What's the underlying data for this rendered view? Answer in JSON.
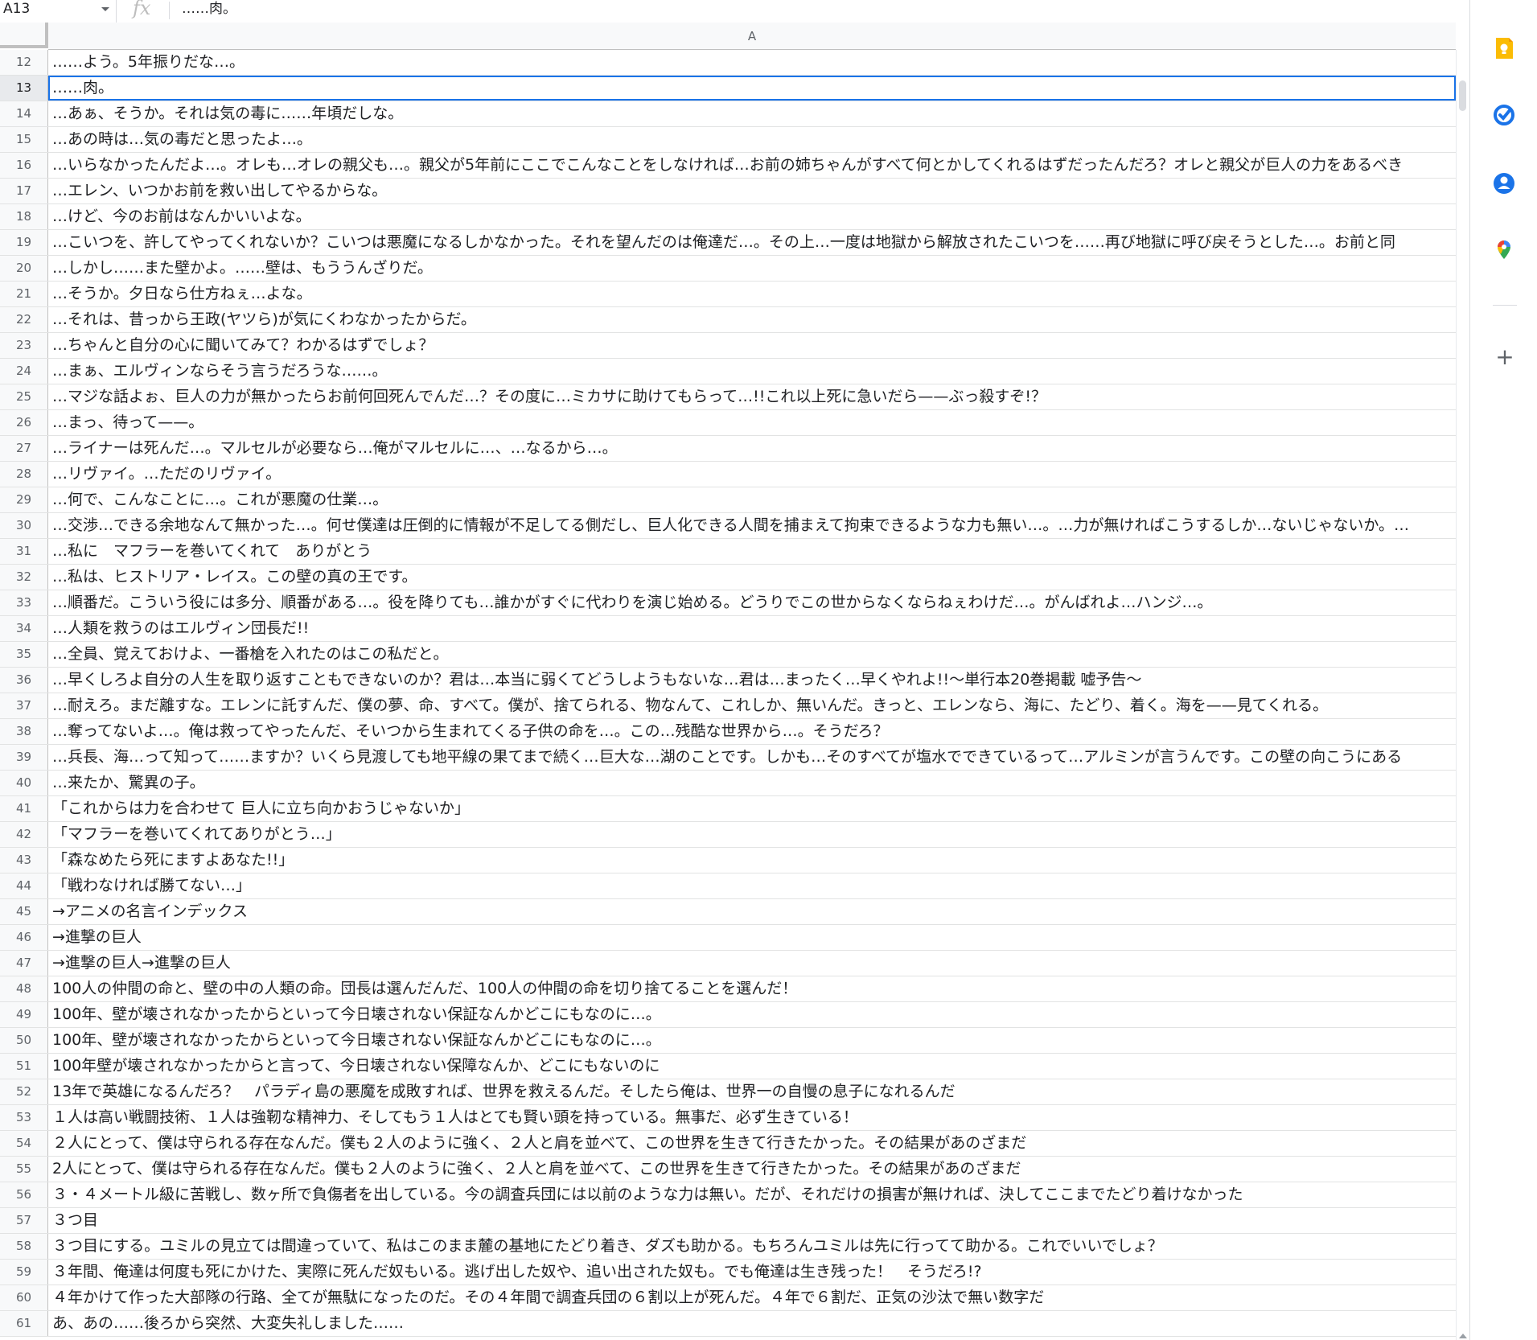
{
  "formula_bar": {
    "name_box": "A13",
    "fx": "fx",
    "value": "……肉。"
  },
  "column_header": "A",
  "rows": [
    {
      "num": "12",
      "text": "……よう。5年振りだな…。"
    },
    {
      "num": "13",
      "text": "……肉。",
      "selected": true
    },
    {
      "num": "14",
      "text": "…あぁ、そうか。それは気の毒に……年頃だしな。"
    },
    {
      "num": "15",
      "text": "…あの時は…気の毒だと思ったよ…。"
    },
    {
      "num": "16",
      "text": "…いらなかったんだよ…。オレも…オレの親父も…。親父が5年前にここでこんなことをしなければ…お前の姉ちゃんがすべて何とかしてくれるはずだったんだろ？オレと親父が巨人の力をあるべき"
    },
    {
      "num": "17",
      "text": "…エレン、いつかお前を救い出してやるからな。"
    },
    {
      "num": "18",
      "text": "…けど、今のお前はなんかいいよな。"
    },
    {
      "num": "19",
      "text": "…こいつを、許してやってくれないか？こいつは悪魔になるしかなかった。それを望んだのは俺達だ…。その上…一度は地獄から解放されたこいつを……再び地獄に呼び戻そうとした…。お前と同"
    },
    {
      "num": "20",
      "text": "…しかし……また壁かよ。……壁は、もううんざりだ。"
    },
    {
      "num": "21",
      "text": "…そうか。夕日なら仕方ねぇ…よな。"
    },
    {
      "num": "22",
      "text": "…それは、昔っから王政(ヤツら)が気にくわなかったからだ。"
    },
    {
      "num": "23",
      "text": "…ちゃんと自分の心に聞いてみて？わかるはずでしょ？"
    },
    {
      "num": "24",
      "text": "…まぁ、エルヴィンならそう言うだろうな……。"
    },
    {
      "num": "25",
      "text": "…マジな話よぉ、巨人の力が無かったらお前何回死んでんだ…？その度に…ミカサに助けてもらって…!!これ以上死に急いだら——ぶっ殺すぞ!？"
    },
    {
      "num": "26",
      "text": "…まっ、待って——。"
    },
    {
      "num": "27",
      "text": "…ライナーは死んだ…。マルセルが必要なら…俺がマルセルに…、…なるから…。"
    },
    {
      "num": "28",
      "text": "…リヴァイ。…ただのリヴァイ。"
    },
    {
      "num": "29",
      "text": "…何で、こんなことに…。これが悪魔の仕業…。"
    },
    {
      "num": "30",
      "text": "…交渉…できる余地なんて無かった…。何せ僕達は圧倒的に情報が不足してる側だし、巨人化できる人間を捕まえて拘束できるような力も無い…。…力が無ければこうするしか…ないじゃないか。…"
    },
    {
      "num": "31",
      "text": "…私に　マフラーを巻いてくれて　ありがとう"
    },
    {
      "num": "32",
      "text": "…私は、ヒストリア・レイス。この壁の真の王です。"
    },
    {
      "num": "33",
      "text": "…順番だ。こういう役には多分、順番がある…。役を降りても…誰かがすぐに代わりを演じ始める。どうりでこの世からなくならねぇわけだ…。がんばれよ…ハンジ…。"
    },
    {
      "num": "34",
      "text": "…人類を救うのはエルヴィン団長だ!!"
    },
    {
      "num": "35",
      "text": "…全員、覚えておけよ、一番槍を入れたのはこの私だと。"
    },
    {
      "num": "36",
      "text": "…早くしろよ自分の人生を取り返すこともできないのか？君は…本当に弱くてどうしようもないな…君は…まったく…早くやれよ!!〜単行本20巻掲載 嘘予告〜"
    },
    {
      "num": "37",
      "text": "…耐えろ。まだ離すな。エレンに託すんだ、僕の夢、命、すべて。僕が、捨てられる、物なんて、これしか、無いんだ。きっと、エレンなら、海に、たどり、着く。海を——見てくれる。"
    },
    {
      "num": "38",
      "text": "…奪ってないよ…。俺は救ってやったんだ、そいつから生まれてくる子供の命を…。この…残酷な世界から…。そうだろ？"
    },
    {
      "num": "39",
      "text": "…兵長、海…って知って……ますか？いくら見渡しても地平線の果てまで続く…巨大な…湖のことです。しかも…そのすべてが塩水でできているって…アルミンが言うんです。この壁の向こうにある"
    },
    {
      "num": "40",
      "text": "…来たか、驚異の子。"
    },
    {
      "num": "41",
      "text": "「これからは力を合わせて 巨人に立ち向かおうじゃないか」"
    },
    {
      "num": "42",
      "text": "「マフラーを巻いてくれてありがとう…」"
    },
    {
      "num": "43",
      "text": "「森なめたら死にますよあなた!!」"
    },
    {
      "num": "44",
      "text": "「戦わなければ勝てない…」"
    },
    {
      "num": "45",
      "text": "→アニメの名言インデックス"
    },
    {
      "num": "46",
      "text": "→進撃の巨人"
    },
    {
      "num": "47",
      "text": "→進撃の巨人→進撃の巨人"
    },
    {
      "num": "48",
      "text": "100人の仲間の命と、壁の中の人類の命。団長は選んだんだ、100人の仲間の命を切り捨てることを選んだ！"
    },
    {
      "num": "49",
      "text": "100年、壁が壊されなかったからといって今日壊されない保証なんかどこにもなのに…。"
    },
    {
      "num": "50",
      "text": "100年、壁が壊されなかったからといって今日壊されない保証なんかどこにもなのに…。"
    },
    {
      "num": "51",
      "text": "100年壁が壊されなかったからと言って、今日壊されない保障なんか、どこにもないのに"
    },
    {
      "num": "52",
      "text": "13年で英雄になるんだろ？　パラディ島の悪魔を成敗すれば、世界を救えるんだ。そしたら俺は、世界一の自慢の息子になれるんだ"
    },
    {
      "num": "53",
      "text": "１人は高い戦闘技術、１人は強靭な精神力、そしてもう１人はとても賢い頭を持っている。無事だ、必ず生きている！"
    },
    {
      "num": "54",
      "text": "２人にとって、僕は守られる存在なんだ。僕も２人のように強く、２人と肩を並べて、この世界を生きて行きたかった。その結果があのざまだ"
    },
    {
      "num": "55",
      "text": "2人にとって、僕は守られる存在なんだ。僕も２人のように強く、２人と肩を並べて、この世界を生きて行きたかった。その結果があのざまだ"
    },
    {
      "num": "56",
      "text": "３・４メートル級に苦戦し、数ヶ所で負傷者を出している。今の調査兵団には以前のような力は無い。だが、それだけの損害が無ければ、決してここまでたどり着けなかった"
    },
    {
      "num": "57",
      "text": "３つ目"
    },
    {
      "num": "58",
      "text": "３つ目にする。ユミルの見立ては間違っていて、私はこのまま麓の基地にたどり着き、ダズも助かる。もちろんユミルは先に行ってて助かる。これでいいでしょ？"
    },
    {
      "num": "59",
      "text": "３年間、俺達は何度も死にかけた、実際に死んだ奴もいる。逃げ出した奴や、追い出された奴も。でも俺達は生き残った！　そうだろ!?"
    },
    {
      "num": "60",
      "text": "４年かけて作った大部隊の行路、全てが無駄になったのだ。その４年間で調査兵団の６割以上が死んだ。４年で６割だ、正気の沙汰で無い数字だ"
    },
    {
      "num": "61",
      "text": "あ、あの……後ろから突然、大変失礼しました……"
    }
  ],
  "side_panel": {
    "icons": [
      "keep-icon",
      "tasks-icon",
      "contacts-icon",
      "maps-icon"
    ],
    "colors": {
      "keep": "#fbbc04",
      "tasks": "#1a73e8",
      "contacts": "#1a73e8",
      "maps_red": "#ea4335",
      "maps_green": "#34a853",
      "maps_yellow": "#fbbc04",
      "maps_blue": "#4285f4"
    }
  }
}
